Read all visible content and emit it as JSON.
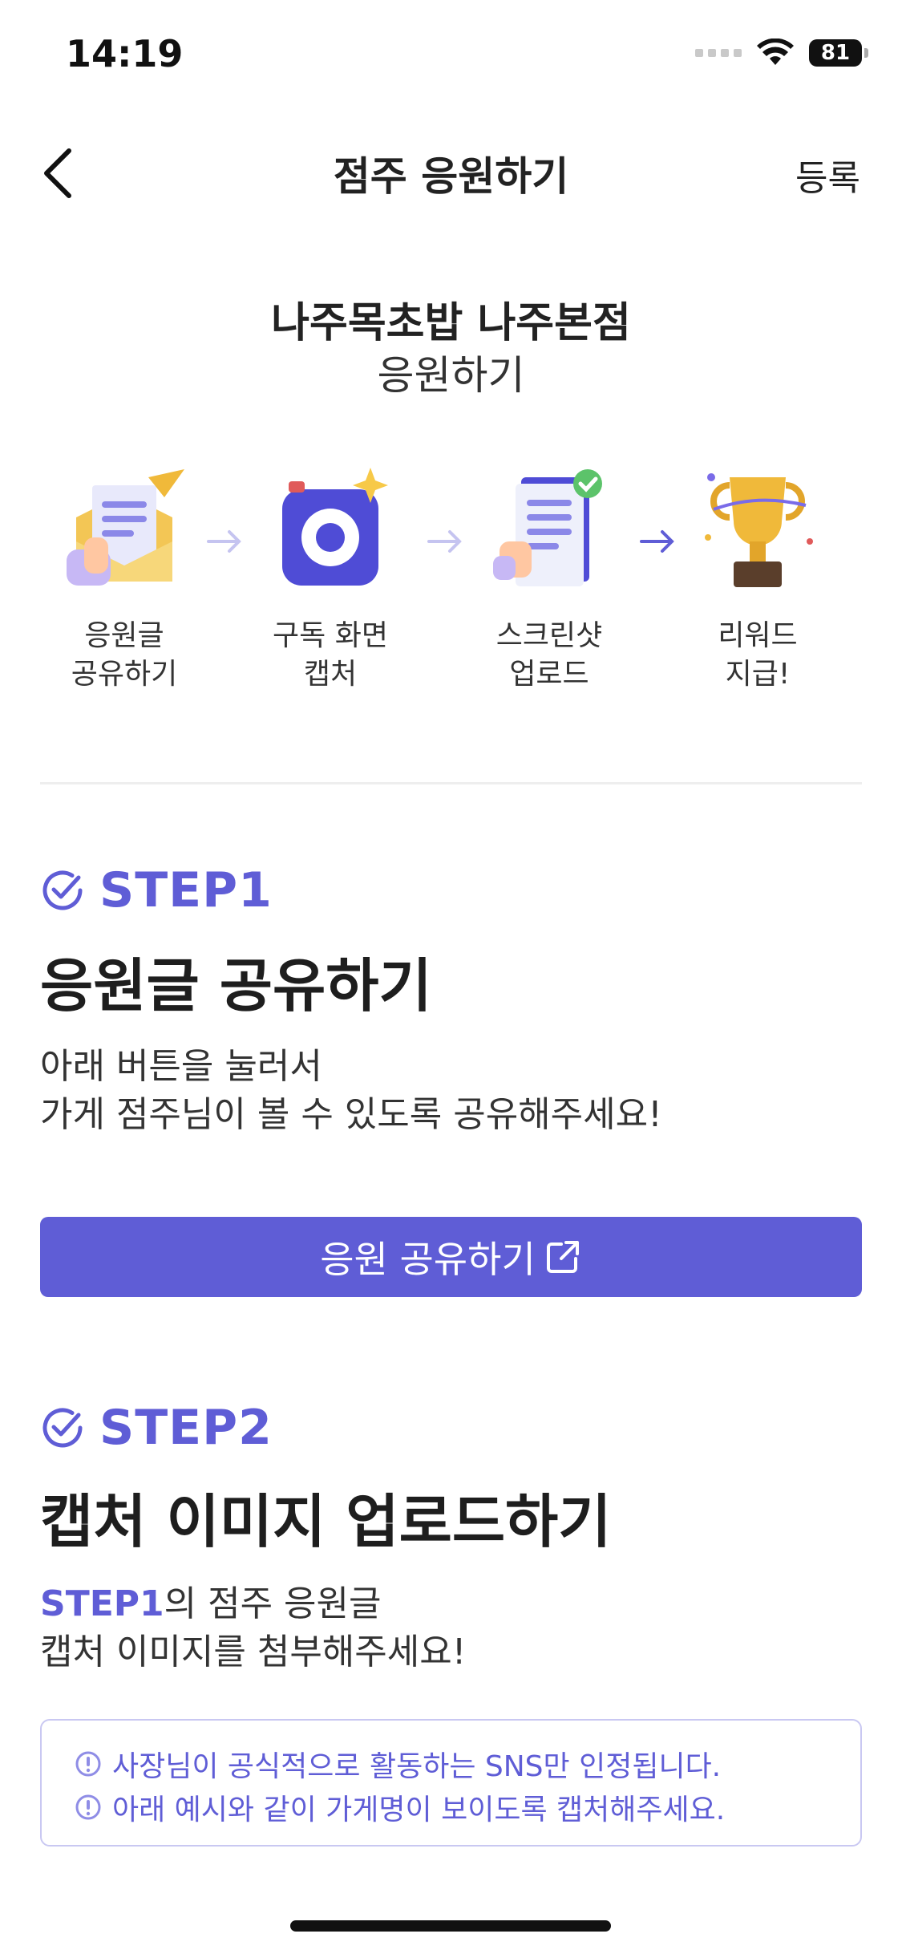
{
  "status_bar": {
    "time": "14:19",
    "battery": "81"
  },
  "nav": {
    "title": "점주 응원하기",
    "register": "등록"
  },
  "header": {
    "store_name": "나주목초밥 나주본점",
    "subtitle": "응원하기"
  },
  "flow": [
    {
      "line1": "응원글",
      "line2": "공유하기",
      "icon": "share-letter-icon"
    },
    {
      "line1": "구독 화면",
      "line2": "캡처",
      "icon": "camera-icon"
    },
    {
      "line1": "스크린샷",
      "line2": "업로드",
      "icon": "document-upload-icon"
    },
    {
      "line1": "리워드",
      "line2": "지급!",
      "icon": "trophy-icon"
    }
  ],
  "step1": {
    "label": "STEP1",
    "title": "응원글 공유하기",
    "desc_line1": "아래 버튼을 눌러서",
    "desc_line2": "가게 점주님이 볼 수 있도록 공유해주세요!",
    "button": "응원 공유하기"
  },
  "step2": {
    "label": "STEP2",
    "title": "캡처 이미지 업로드하기",
    "desc_accent": "STEP1",
    "desc_line1_rest": "의 점주 응원글",
    "desc_line2": "캡처 이미지를 첨부해주세요!",
    "notices": [
      "사장님이 공식적으로 활동하는 SNS만 인정됩니다.",
      "아래 예시와 같이 가게명이 보이도록 캡처해주세요."
    ]
  },
  "colors": {
    "accent": "#5f5dd6",
    "notice_border": "#c9c8f2"
  }
}
